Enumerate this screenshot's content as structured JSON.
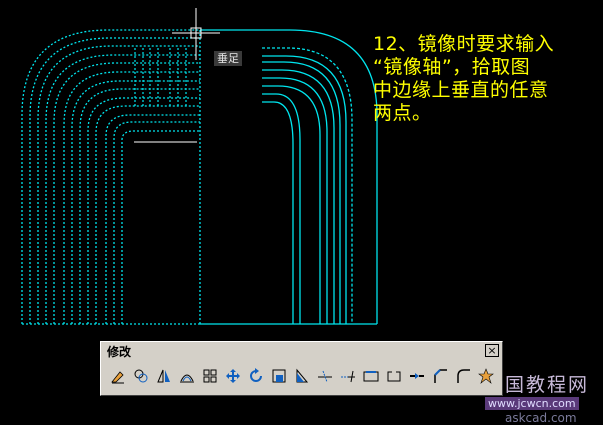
{
  "caption": {
    "lines": [
      "12、镜像时要求输入",
      "“镜像轴”，拾取图",
      "中边缘上垂直的任意",
      "两点。"
    ]
  },
  "snap_tooltip": "垂足",
  "toolbar": {
    "title": "修改",
    "close_label": "×",
    "buttons": [
      {
        "name": "erase-icon"
      },
      {
        "name": "copy-icon"
      },
      {
        "name": "mirror-icon"
      },
      {
        "name": "offset-icon"
      },
      {
        "name": "array-icon"
      },
      {
        "name": "move-icon"
      },
      {
        "name": "rotate-icon"
      },
      {
        "name": "scale-icon"
      },
      {
        "name": "stretch-icon"
      },
      {
        "name": "trim-icon"
      },
      {
        "name": "extend-icon"
      },
      {
        "name": "break-at-point-icon"
      },
      {
        "name": "break-icon"
      },
      {
        "name": "join-icon"
      },
      {
        "name": "chamfer-icon"
      },
      {
        "name": "fillet-icon"
      },
      {
        "name": "explode-icon"
      }
    ]
  },
  "watermark": {
    "main": "国教程网",
    "url": "www.jcwcn.com",
    "sub": "askcad.com"
  },
  "colors": {
    "drawing": "#00e5ee",
    "caption": "#ffff00",
    "background": "#000000"
  }
}
